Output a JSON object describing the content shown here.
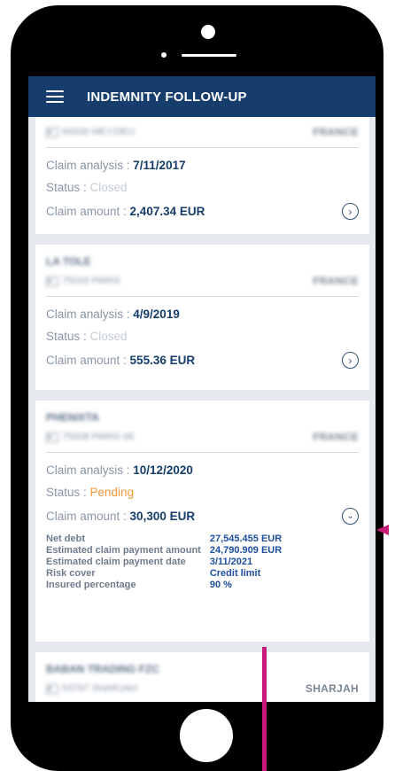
{
  "app": {
    "title": "INDEMNITY FOLLOW-UP",
    "menu_icon": "hamburger-menu-icon"
  },
  "claims": [
    {
      "company": "",
      "location": "69330 MEYZIEU",
      "country": "FRANCE",
      "analysis_label": "Claim analysis : ",
      "analysis_date": "7/11/2017",
      "status_label": "Status : ",
      "status": "Closed",
      "amount_label": "Claim amount : ",
      "amount": "2,407.34 EUR",
      "action_icon": "chevron-right-circle-icon"
    },
    {
      "company": "LA TOLE",
      "location": "75018 PARIS",
      "country": "FRANCE",
      "analysis_label": "Claim analysis : ",
      "analysis_date": "4/9/2019",
      "status_label": "Status : ",
      "status": "Closed",
      "amount_label": "Claim amount : ",
      "amount": "555.36 EUR",
      "action_icon": "chevron-right-circle-icon"
    },
    {
      "company": "PHENIXTA",
      "location": "75008 PARIS 08",
      "country": "FRANCE",
      "analysis_label": "Claim analysis : ",
      "analysis_date": "10/12/2020",
      "status_label": "Status : ",
      "status": "Pending",
      "amount_label": "Claim amount : ",
      "amount": "30,300 EUR",
      "action_icon": "chevron-down-circle-icon",
      "details": {
        "labels": [
          "Net debt",
          "Estimated claim payment amount",
          "Estimated claim payment date",
          "Risk cover",
          "Insured percentage"
        ],
        "values": [
          "27,545.455 EUR",
          "24,790.909 EUR",
          "3/11/2021",
          "Credit limit",
          "90 %"
        ]
      }
    },
    {
      "company": "BABAN TRADING FZC",
      "location": "53797 SHARJAH",
      "country": "SHARJAH"
    }
  ],
  "colors": {
    "header": "#163d6c",
    "accent": "#163d6c",
    "pending": "#f2973b",
    "annotation": "#c81a78"
  }
}
